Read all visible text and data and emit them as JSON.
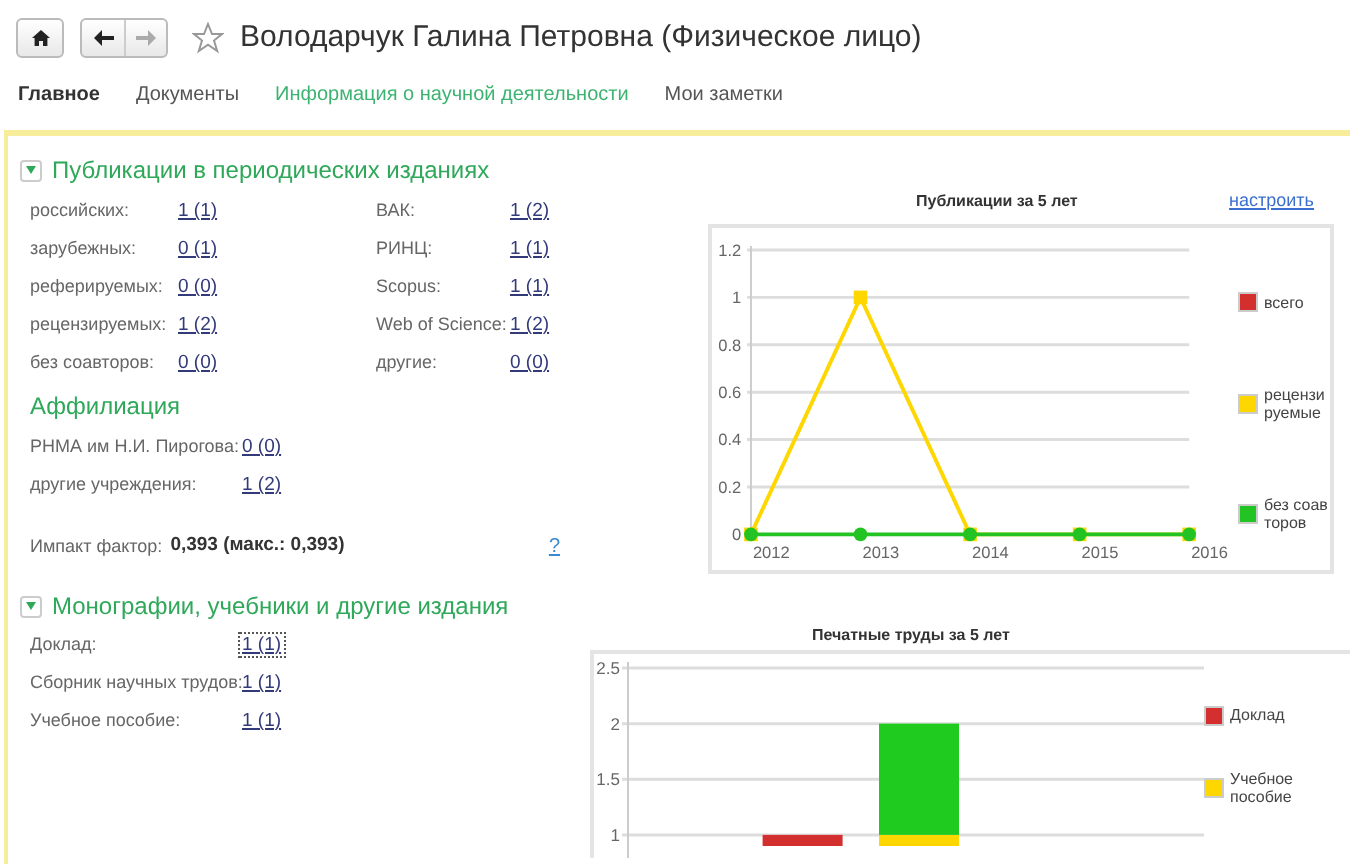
{
  "toolbar": {
    "back_disabled": false,
    "forward_disabled": true,
    "favorite": false,
    "title": "Володарчук Галина Петровна (Физическое лицо)"
  },
  "tabs": [
    {
      "label": "Главное",
      "selected": true,
      "highlighted": false
    },
    {
      "label": "Документы",
      "selected": false,
      "highlighted": false
    },
    {
      "label": "Информация о научной деятельности",
      "selected": false,
      "highlighted": true
    },
    {
      "label": "Мои заметки",
      "selected": false,
      "highlighted": false
    }
  ],
  "publications": {
    "title": "Публикации в периодических изданиях",
    "expanded": true,
    "fields_left": [
      {
        "label": "российских:",
        "value": "1 (1)"
      },
      {
        "label": "зарубежных:",
        "value": "0 (1)"
      },
      {
        "label": "реферируемых:",
        "value": "0 (0)"
      },
      {
        "label": "рецензируемых:",
        "value": "1 (2)"
      },
      {
        "label": "без соавторов:",
        "value": "0 (0)"
      }
    ],
    "fields_right": [
      {
        "label": "ВАК:",
        "value": "1 (2)"
      },
      {
        "label": "РИНЦ:",
        "value": "1 (1)"
      },
      {
        "label": "Scopus:",
        "value": "1 (1)"
      },
      {
        "label": "Web of Science:",
        "value": "1 (2)"
      },
      {
        "label": "другие:",
        "value": "0 (0)"
      }
    ],
    "affiliation": {
      "title": "Аффилиация",
      "fields": [
        {
          "label": "РНМА им Н.И. Пирогова:",
          "value": "0 (0)"
        },
        {
          "label": "другие учреждения:",
          "value": "1 (2)"
        }
      ]
    },
    "impact": {
      "label": "Импакт фактор:",
      "value": "0,393 (макс.: 0,393)",
      "help": "?"
    },
    "chart": {
      "title": "Публикации за 5 лет",
      "settings_link": "настроить",
      "chart_data": {
        "type": "line",
        "x": [
          "2012",
          "2013",
          "2014",
          "2015",
          "2016"
        ],
        "ylim": [
          0,
          1.2
        ],
        "yticks": [
          0,
          0.2,
          0.4,
          0.6,
          0.8,
          1,
          1.2
        ],
        "grid": true,
        "legend": "right",
        "series": [
          {
            "name": "всего",
            "color": "#d32f2f",
            "values": [
              null,
              null,
              null,
              null,
              null
            ]
          },
          {
            "name": "рецензируемые",
            "color": "#ffd700",
            "marker": "square",
            "values": [
              0,
              1,
              0,
              0,
              0
            ]
          },
          {
            "name": "без соавторов",
            "color": "#22c322",
            "marker": "circle",
            "values": [
              0,
              0,
              0,
              0,
              0
            ]
          }
        ]
      }
    }
  },
  "monographs": {
    "title": "Монографии, учебники и другие издания",
    "expanded": true,
    "fields": [
      {
        "label": "Доклад:",
        "value": "1 (1)",
        "focused": true
      },
      {
        "label": "Сборник научных трудов:",
        "value": "1 (1)",
        "focused": false
      },
      {
        "label": "Учебное пособие:",
        "value": "1 (1)",
        "focused": false
      }
    ],
    "chart": {
      "title": "Печатные труды  за 5 лет",
      "chart_data": {
        "type": "bar",
        "stacked": true,
        "ylim": [
          0.9,
          2.5
        ],
        "yticks": [
          1,
          1.5,
          2,
          2.5
        ],
        "grid": true,
        "legend": "right",
        "series": [
          {
            "name": "Доклад",
            "color": "#d32f2f",
            "values": [
              1,
              null
            ]
          },
          {
            "name": "Учебное пособие",
            "color": "#ffd700",
            "values": [
              null,
              1
            ]
          },
          {
            "color": "#1ecb1e",
            "values": [
              null,
              1
            ]
          }
        ]
      }
    }
  }
}
